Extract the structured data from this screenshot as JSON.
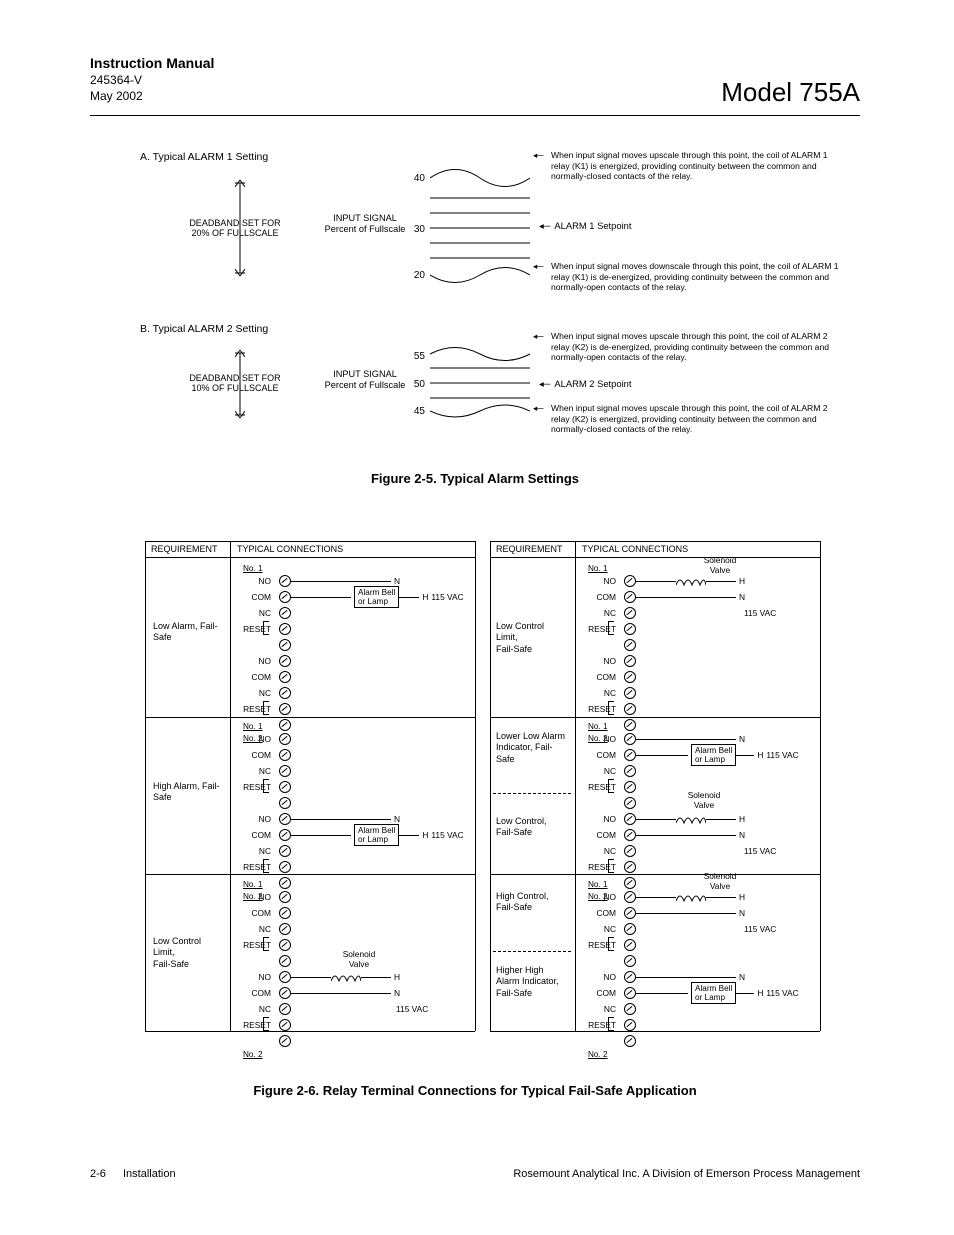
{
  "header": {
    "title": "Instruction Manual",
    "docnum": "245364-V",
    "date": "May 2002",
    "model": "Model 755A"
  },
  "fig25": {
    "sectionA": {
      "title": "A.  Typical ALARM 1 Setting",
      "deadband": "DEADBAND SET FOR 20% OF FULLSCALE",
      "inputSignal": "INPUT SIGNAL",
      "inputSignalSub": "Percent of Fullscale",
      "ticks": [
        "40",
        "30",
        "20"
      ],
      "desc_top": "When input signal moves upscale through this point, the coil of ALARM 1 relay (K1) is energized, providing continuity between the common and normally-closed contacts of the relay.",
      "setpoint": "ALARM 1 Setpoint",
      "desc_bottom": "When input signal moves downscale through this point, the coil of ALARM 1 relay (K1) is de-energized, providing continuity between the common and normally-open contacts of the relay."
    },
    "sectionB": {
      "title": "B.  Typical ALARM 2 Setting",
      "deadband": "DEADBAND SET FOR 10% OF FULLSCALE",
      "inputSignal": "INPUT SIGNAL",
      "inputSignalSub": "Percent of Fullscale",
      "ticks": [
        "55",
        "50",
        "45"
      ],
      "desc_top": "When input signal moves upscale through this point, the coil of ALARM 2 relay (K2) is de-energized, providing continuity between the common and normally-open contacts of the relay.",
      "setpoint": "ALARM 2 Setpoint",
      "desc_bottom": "When input signal moves upscale through this point, the coil of ALARM 2 relay (K2) is energized, providing continuity between the common and normally-closed contacts of the relay."
    },
    "caption": "Figure 2-5.  Typical Alarm Settings"
  },
  "fig26": {
    "headers": {
      "req": "REQUIREMENT",
      "conn": "TYPICAL CONNECTIONS"
    },
    "labels": {
      "no1": "No. 1",
      "no2": "No. 2",
      "NO": "NO",
      "COM": "COM",
      "NC": "NC",
      "RESET": "RESET",
      "N": "N",
      "H": "H",
      "ac": "115 VAC",
      "alarmBell": "Alarm Bell",
      "orLamp": "or Lamp",
      "solenoid": "Solenoid",
      "valve": "Valve"
    },
    "requirements": {
      "r1": "Low Alarm, Fail-Safe",
      "r2": "High Alarm, Fail-Safe",
      "r3": "Low Control Limit,\nFail-Safe",
      "r4": "Low Control Limit,\nFail-Safe",
      "r5a": "Lower Low Alarm Indicator, Fail-Safe",
      "r5b": "Low Control, Fail-Safe",
      "r6a": "High Control, Fail-Safe",
      "r6b": "Higher High Alarm Indicator, Fail-Safe"
    },
    "caption": "Figure 2-6.  Relay Terminal Connections for Typical Fail-Safe Application"
  },
  "footer": {
    "pagenum": "2-6",
    "section": "Installation",
    "company": "Rosemount Analytical Inc.    A Division of Emerson Process Management"
  }
}
